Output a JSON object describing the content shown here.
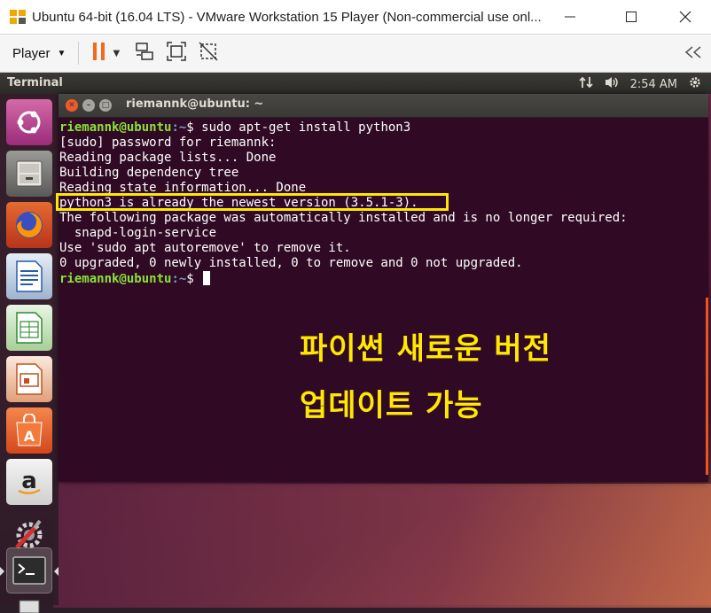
{
  "window": {
    "title": "Ubuntu 64-bit (16.04 LTS) - VMware Workstation 15 Player (Non-commercial use onl...",
    "buttons": [
      "minimize",
      "maximize",
      "close"
    ]
  },
  "toolbar": {
    "player_label": "Player",
    "icons": [
      "pause-icon",
      "send-keys-icon",
      "fit-guest-icon",
      "unity-icon",
      "collapse-icon"
    ]
  },
  "ubuntu_panel": {
    "app_title": "Terminal",
    "time": "2:54 AM"
  },
  "launcher": {
    "items": [
      "ubuntu-dash",
      "files",
      "firefox",
      "libreoffice-writer",
      "libreoffice-calc",
      "libreoffice-impress",
      "ubuntu-software",
      "amazon",
      "system-settings",
      "terminal"
    ],
    "active": "terminal"
  },
  "terminal": {
    "title": "riemannk@ubuntu: ~",
    "prompt_user": "riemannk@ubuntu",
    "prompt_path": ":~",
    "prompt_symbol": "$",
    "lines": [
      {
        "type": "command",
        "text": " sudo apt-get install python3"
      },
      {
        "type": "output",
        "text": "[sudo] password for riemannk:"
      },
      {
        "type": "output",
        "text": "Reading package lists... Done"
      },
      {
        "type": "output",
        "text": "Building dependency tree"
      },
      {
        "type": "output",
        "text": "Reading state information... Done"
      },
      {
        "type": "output",
        "text": "python3 is already the newest version (3.5.1-3)."
      },
      {
        "type": "output",
        "text": "The following package was automatically installed and is no longer required:"
      },
      {
        "type": "output",
        "text": "  snapd-login-service"
      },
      {
        "type": "output",
        "text": "Use 'sudo apt autoremove' to remove it."
      },
      {
        "type": "output",
        "text": "0 upgraded, 0 newly installed, 0 to remove and 0 not upgraded."
      },
      {
        "type": "prompt",
        "text": " "
      }
    ]
  },
  "annotation": {
    "line1": "파이썬 새로운 버전",
    "line2": "업데이트 가능",
    "color": "#ffe800"
  }
}
